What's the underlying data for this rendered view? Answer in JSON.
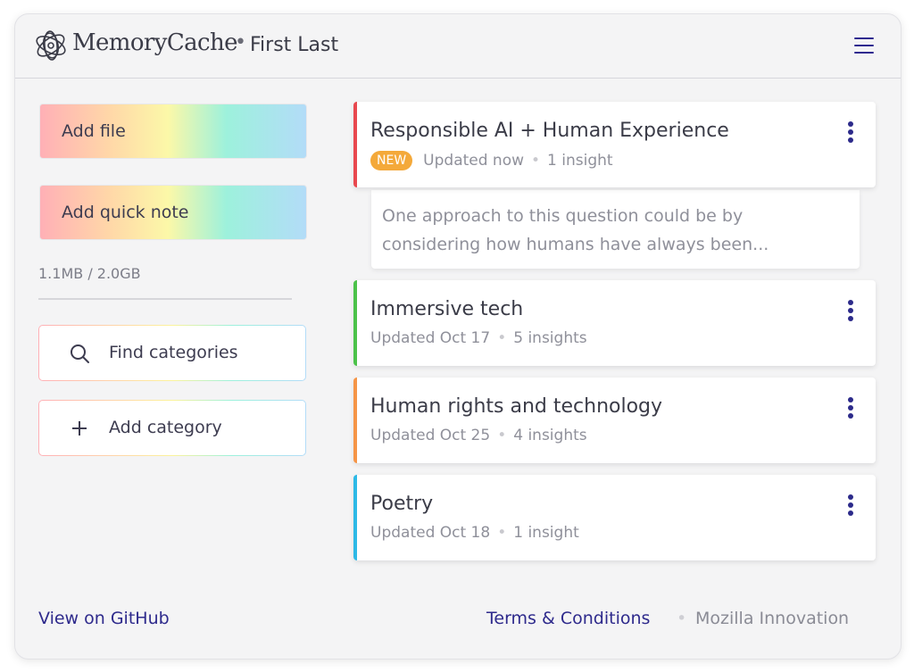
{
  "header": {
    "brand": "MemoryCache",
    "separator": "•",
    "user_name": "First Last",
    "menu_icon": "hamburger-menu-icon",
    "logo_icon": "memorycache-logo-icon"
  },
  "sidebar": {
    "add_file_label": "Add file",
    "add_note_label": "Add quick note",
    "storage_text": "1.1MB / 2.0GB",
    "find_categories_label": "Find categories",
    "find_icon": "search-icon",
    "add_category_label": "Add category",
    "add_icon": "plus-icon"
  },
  "categories": [
    {
      "title": "Responsible AI + Human Experience",
      "badge": "NEW",
      "updated": "Updated now",
      "insights": "1 insight",
      "accent": "#e8484f",
      "preview": "One approach to this question could be by considering how humans have always been..."
    },
    {
      "title": "Immersive tech",
      "updated": "Updated Oct 17",
      "insights": "5 insights",
      "accent": "#4cc24a"
    },
    {
      "title": "Human rights and technology",
      "updated": "Updated Oct 25",
      "insights": "4 insights",
      "accent": "#f59547"
    },
    {
      "title": "Poetry",
      "updated": "Updated Oct 18",
      "insights": "1 insight",
      "accent": "#2db9e6"
    }
  ],
  "footer": {
    "github_link": "View on GitHub",
    "terms_link": "Terms & Conditions",
    "separator": "•",
    "org": "Mozilla Innovation"
  },
  "colors": {
    "accent_indigo": "#2e2a8c",
    "new_badge": "#f4a93a"
  }
}
